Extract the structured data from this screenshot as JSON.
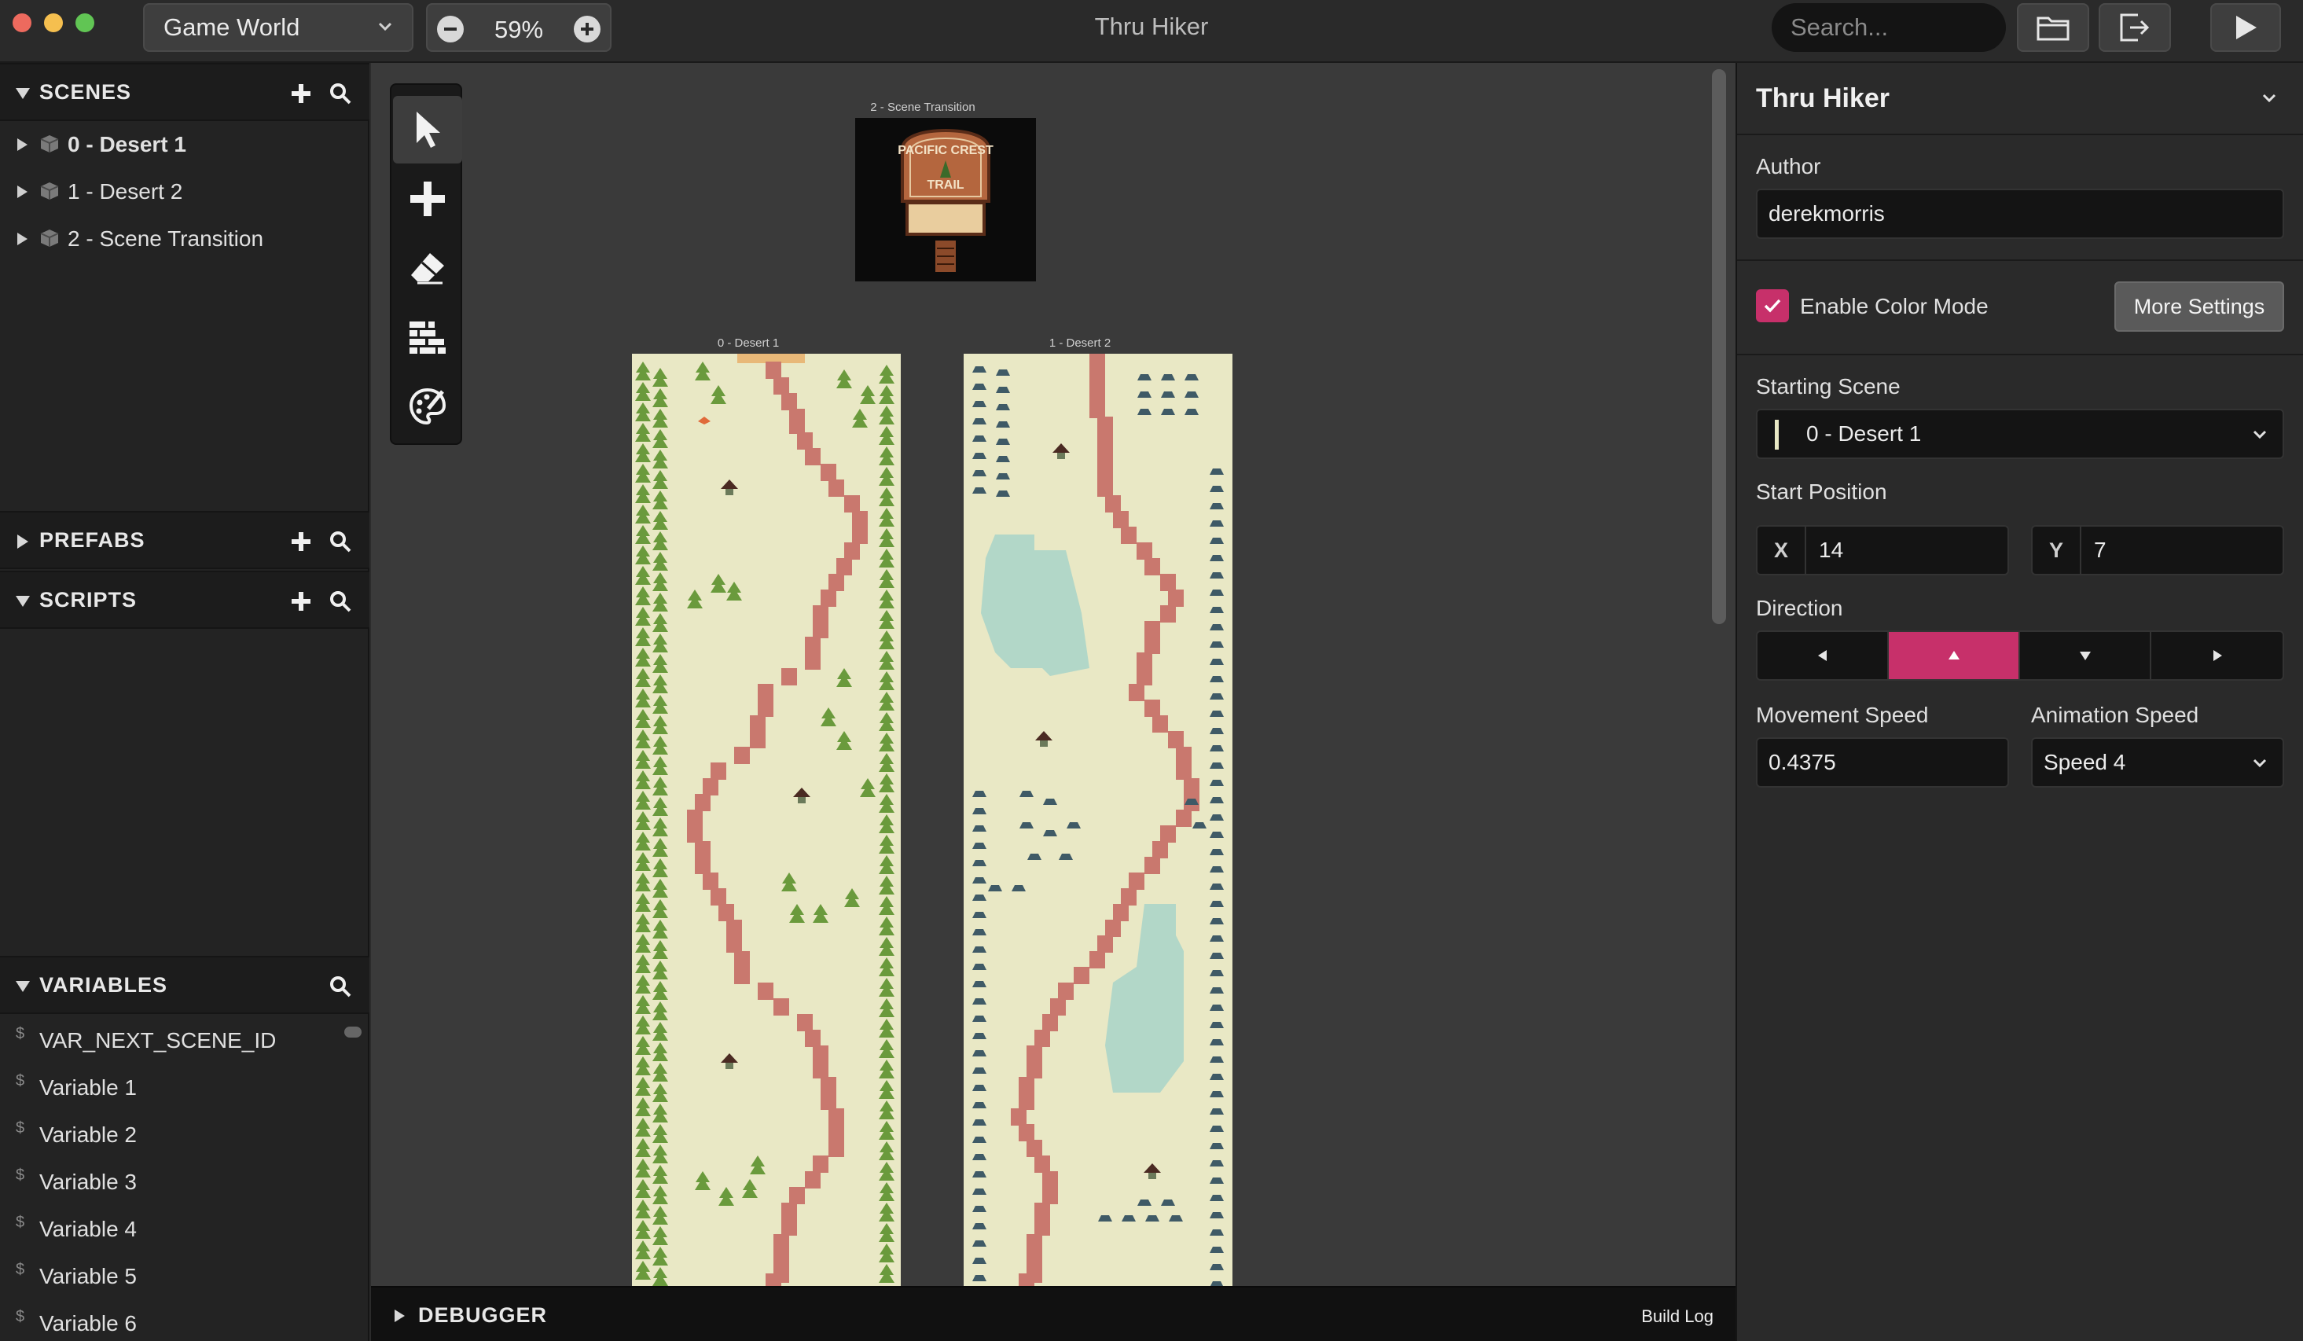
{
  "window": {
    "title": "Thru Hiker",
    "world_select": "Game World",
    "zoom": "59%",
    "search_placeholder": "Search..."
  },
  "sidebar": {
    "scenes_header": "SCENES",
    "scenes": [
      {
        "label": "0 - Desert 1",
        "active": true
      },
      {
        "label": "1 - Desert 2",
        "active": false
      },
      {
        "label": "2 - Scene Transition",
        "active": false
      }
    ],
    "prefabs_header": "PREFABS",
    "scripts_header": "SCRIPTS",
    "variables_header": "VARIABLES",
    "variables": [
      "VAR_NEXT_SCENE_ID",
      "Variable 1",
      "Variable 2",
      "Variable 3",
      "Variable 4",
      "Variable 5",
      "Variable 6"
    ]
  },
  "canvas": {
    "scenes": [
      {
        "label": "2 - Scene Transition"
      },
      {
        "label": "0 - Desert 1"
      },
      {
        "label": "1 - Desert 2"
      }
    ],
    "sign_text_top": "PACIFIC CREST",
    "sign_text_bottom": "TRAIL"
  },
  "debugger": {
    "label": "DEBUGGER",
    "build_log": "Build Log"
  },
  "panel": {
    "title": "Thru Hiker",
    "author_label": "Author",
    "author_value": "derekmorris",
    "color_mode_label": "Enable Color Mode",
    "color_mode_checked": true,
    "more_settings": "More Settings",
    "starting_scene_label": "Starting Scene",
    "starting_scene_value": "0 - Desert 1",
    "start_position_label": "Start Position",
    "x_label": "X",
    "x_value": "14",
    "y_label": "Y",
    "y_value": "7",
    "direction_label": "Direction",
    "direction_selected": "up",
    "movement_speed_label": "Movement Speed",
    "movement_speed_value": "0.4375",
    "animation_speed_label": "Animation Speed",
    "animation_speed_value": "Speed 4"
  },
  "colors": {
    "accent": "#c7306a",
    "scene_ground": "#e9e8c5",
    "path": "#c9786e",
    "tree": "#6a9a3c",
    "water": "#a8d4c8",
    "rock": "#3f5a66"
  }
}
